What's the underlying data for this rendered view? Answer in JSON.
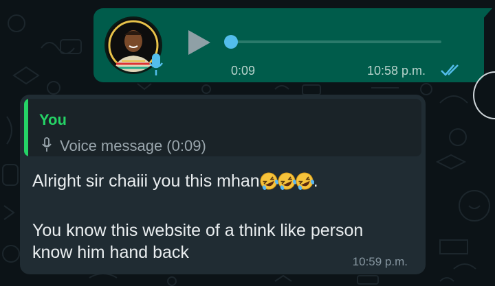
{
  "voice_message": {
    "duration": "0:09",
    "time": "10:58 p.m.",
    "status_icon": "double-check-icon",
    "status_color": "#53bdeb",
    "progress": 0
  },
  "reply_message": {
    "quote": {
      "author": "You",
      "text": "Voice message (0:09)"
    },
    "text_before_emoji": "Alright sir chaiii you this mhan",
    "emoji_icon": "rolling-on-the-floor-laughing-emoji",
    "emoji_count": 3,
    "text_after_emoji": ".",
    "line2": "You know this website of a think like person",
    "line3": "know him hand back",
    "time": "10:59 p.m."
  },
  "colors": {
    "outgoing_bubble": "#005c4b",
    "incoming_bubble": "#202c33",
    "background": "#0b141a",
    "accent_green": "#25d366",
    "playhead_blue": "#53bdeb"
  }
}
